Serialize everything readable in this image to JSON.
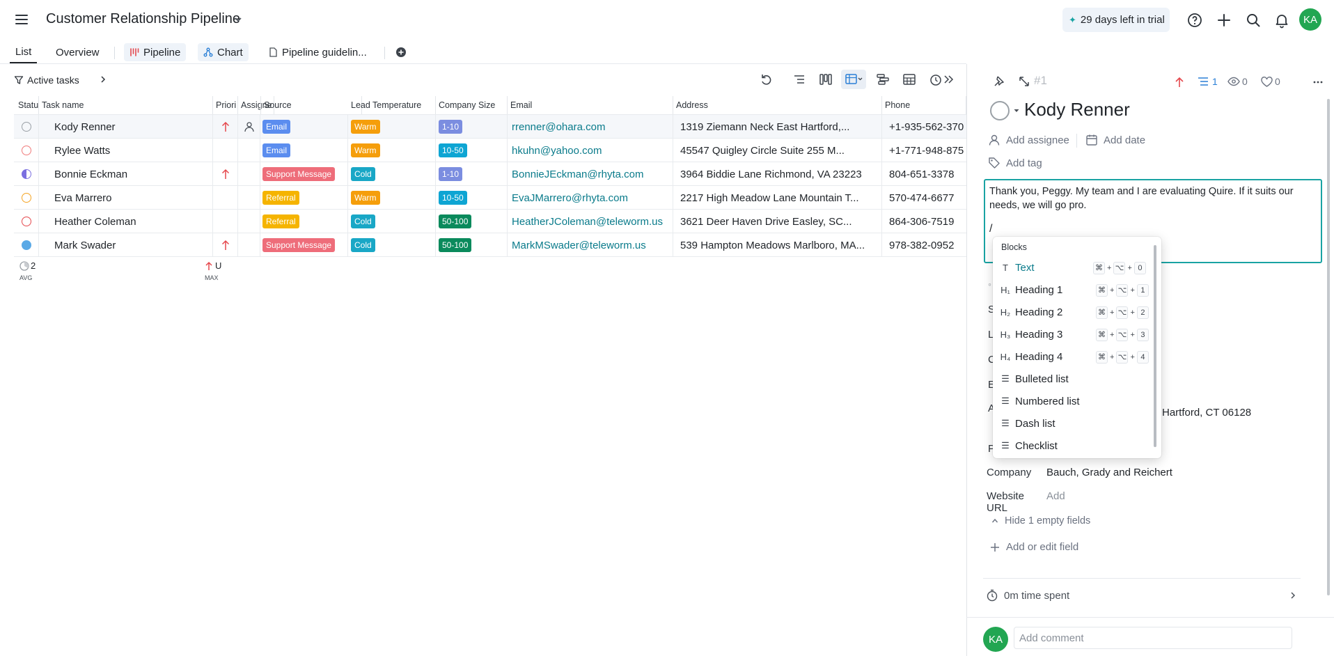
{
  "app": {
    "title": "Customer Relationship Pipeline",
    "trial": "29 days left in trial",
    "avatar_initials": "KA",
    "accent_color": "#0a7b8b"
  },
  "tabs": [
    {
      "label": "List",
      "icon": "none"
    },
    {
      "label": "Overview",
      "icon": "none"
    },
    {
      "label": "Pipeline",
      "icon": "board-icon"
    },
    {
      "label": "Chart",
      "icon": "chart-icon"
    },
    {
      "label": "Pipeline guidelin...",
      "icon": "document-icon"
    }
  ],
  "toolbar": {
    "filter_label": "Active tasks"
  },
  "table": {
    "columns": [
      "Statu",
      "Task name",
      "Priori",
      "Assigne",
      "Source",
      "Lead Temperature",
      "Company Size",
      "Email",
      "Address",
      "Phone"
    ],
    "rows": [
      {
        "name": "Kody Renner",
        "priority": "high",
        "source": "Email",
        "source_color": "#5b8def",
        "temp": "Warm",
        "temp_color": "#f59e0b",
        "size": "1-10",
        "size_color": "#7b8de0",
        "email": "rrenner@ohara.com",
        "address": "1319 Ziemann Neck East Hartford,...",
        "phone": "+1-935-562-370",
        "status_color": "#9aa0a6"
      },
      {
        "name": "Rylee Watts",
        "priority": "",
        "source": "Email",
        "source_color": "#5b8def",
        "temp": "Warm",
        "temp_color": "#f59e0b",
        "size": "10-50",
        "size_color": "#0ea5d3",
        "email": "hkuhn@yahoo.com",
        "address": "45547 Quigley Circle Suite 255 M...",
        "phone": "+1-771-948-875",
        "status_color": "#f07a7a"
      },
      {
        "name": "Bonnie Eckman",
        "priority": "high",
        "source": "Support Message",
        "source_color": "#ee6d7a",
        "temp": "Cold",
        "temp_color": "#19a7c6",
        "size": "1-10",
        "size_color": "#7b8de0",
        "email": "BonnieJEckman@rhyta.com",
        "address": "3964 Biddie Lane Richmond, VA 23223",
        "phone": "804-651-3378",
        "status_color": "#7b6fe0"
      },
      {
        "name": "Eva Marrero",
        "priority": "",
        "source": "Referral",
        "source_color": "#f5b400",
        "temp": "Warm",
        "temp_color": "#f59e0b",
        "size": "10-50",
        "size_color": "#0ea5d3",
        "email": "EvaJMarrero@rhyta.com",
        "address": "2217 High Meadow Lane Mountain T...",
        "phone": "570-474-6677",
        "status_color": "#f5a524"
      },
      {
        "name": "Heather Coleman",
        "priority": "",
        "source": "Referral",
        "source_color": "#f5b400",
        "temp": "Cold",
        "temp_color": "#19a7c6",
        "size": "50-100",
        "size_color": "#0a8a5c",
        "email": "HeatherJColeman@teleworm.us",
        "address": "3621 Deer Haven Drive Easley, SC...",
        "phone": "864-306-7519",
        "status_color": "#e5484d"
      },
      {
        "name": "Mark Swader",
        "priority": "high",
        "source": "Support Message",
        "source_color": "#ee6d7a",
        "temp": "Cold",
        "temp_color": "#19a7c6",
        "size": "50-100",
        "size_color": "#0a8a5c",
        "email": "MarkMSwader@teleworm.us",
        "address": "539 Hampton Meadows Marlboro, MA...",
        "phone": "978-382-0952",
        "status_color": "#5aa9e6"
      }
    ],
    "footer": {
      "status_value": "2",
      "status_agg": "AVG",
      "priority_value": "U",
      "priority_agg": "MAX"
    }
  },
  "panel": {
    "task_id": "#1",
    "subtask_count": "1",
    "watchers": "0",
    "likes": "0",
    "title": "Kody Renner",
    "add_assignee": "Add assignee",
    "add_date": "Add date",
    "add_tag": "Add tag",
    "description": "Thank you, Peggy. My team and I are evaluating Quire. If it suits our needs, we will go pro.",
    "slash": "/",
    "address_visible": "Hartford, CT 06128",
    "fields": [
      {
        "label": "Company",
        "value": "Bauch, Grady and Reichert"
      },
      {
        "label": "Website URL",
        "value": "Add"
      }
    ],
    "hide_empty": "Hide 1 empty fields",
    "add_field": "Add or edit field",
    "time_spent": "0m time spent",
    "comment_placeholder": "Add comment"
  },
  "block_menu": {
    "header": "Blocks",
    "items": [
      {
        "label": "Text",
        "icon": "T",
        "shortcut": [
          "⌘",
          "+",
          "⌥",
          "+",
          "0"
        ]
      },
      {
        "label": "Heading 1",
        "icon": "H₁",
        "shortcut": [
          "⌘",
          "+",
          "⌥",
          "+",
          "1"
        ]
      },
      {
        "label": "Heading 2",
        "icon": "H₂",
        "shortcut": [
          "⌘",
          "+",
          "⌥",
          "+",
          "2"
        ]
      },
      {
        "label": "Heading 3",
        "icon": "H₃",
        "shortcut": [
          "⌘",
          "+",
          "⌥",
          "+",
          "3"
        ]
      },
      {
        "label": "Heading 4",
        "icon": "H₄",
        "shortcut": [
          "⌘",
          "+",
          "⌥",
          "+",
          "4"
        ]
      },
      {
        "label": "Bulleted list",
        "icon": "☰",
        "shortcut": []
      },
      {
        "label": "Numbered list",
        "icon": "☰",
        "shortcut": []
      },
      {
        "label": "Dash list",
        "icon": "☰",
        "shortcut": []
      },
      {
        "label": "Checklist",
        "icon": "☰",
        "shortcut": []
      }
    ]
  }
}
